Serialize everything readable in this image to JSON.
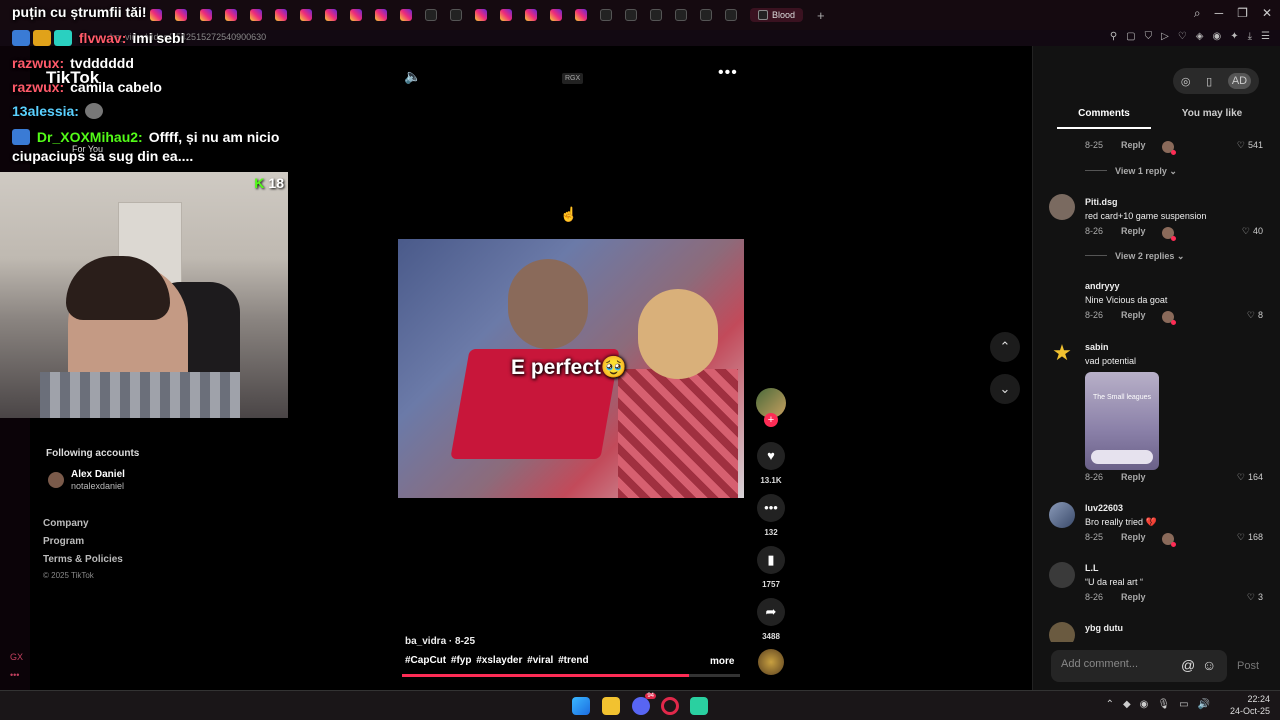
{
  "browser": {
    "active_tab_label": "Blood",
    "url": "ba_vidra/video/7542515272540900630",
    "new_tab_symbol": "+"
  },
  "chat": [
    {
      "user": "",
      "text": "puțin cu ștrumfii tăi!",
      "color": "#ffffff"
    },
    {
      "user": "flvwav:",
      "text": "imi sebi",
      "color": "#ff5a6a"
    },
    {
      "user": "razwux:",
      "text": "tvdddddd",
      "color": "#ff5a6a"
    },
    {
      "user": "razwux:",
      "text": "camila cabelo",
      "color": "#ff5a6a"
    },
    {
      "user": "13alessia:",
      "text": "",
      "color": "#5ad0ff"
    },
    {
      "user": "Dr_XOXMihau2:",
      "text": "Offff, și nu am nicio",
      "color": "#53fc18"
    },
    {
      "user": "",
      "text": "ciupaciups sa sug din ea....",
      "color": "#ffffff"
    }
  ],
  "webcam": {
    "counter": "18"
  },
  "tiktok_left": {
    "logo": "TikTok",
    "nav_item": "For You",
    "following_title": "Following accounts",
    "account_name": "Alex Daniel",
    "account_handle": "notalexdaniel",
    "footer_links": [
      "Company",
      "Program",
      "Terms & Policies"
    ],
    "copyright": "© 2025 TikTok"
  },
  "video": {
    "badge": "RGX",
    "caption": "E perfect🥹",
    "author_line": "ba_vidra · 8-25",
    "tags": "#CapCut #fyp #xslayder #viral #trend",
    "more": "more",
    "progress_fraction": 0.85,
    "likes": "13.1K",
    "comments": "132",
    "saves": "1757",
    "shares": "3488"
  },
  "comments_panel": {
    "tabs": [
      "Comments",
      "You may like"
    ],
    "items": [
      {
        "user": "",
        "text": "",
        "date": "8-25",
        "reply": "Reply",
        "likes": "541",
        "replies_label": "View 1 reply"
      },
      {
        "user": "Piti.dsg",
        "text": "red card+10 game suspension",
        "date": "8-26",
        "reply": "Reply",
        "likes": "40",
        "replies_label": "View 2 replies"
      },
      {
        "user": "andryyy",
        "text": "Nine Vicious da goat",
        "date": "8-26",
        "reply": "Reply",
        "likes": "8"
      },
      {
        "user": "sabin",
        "text": "vad potential",
        "date": "8-26",
        "reply": "Reply",
        "likes": "164",
        "sticker_text": "The Small leagues"
      },
      {
        "user": "luv22603",
        "text": "Bro really tried 💔",
        "date": "8-25",
        "reply": "Reply",
        "likes": "168"
      },
      {
        "user": "L.L",
        "text": "“U da real art “",
        "date": "8-26",
        "reply": "Reply",
        "likes": "3"
      },
      {
        "user": "ybg dutu",
        "text": "",
        "date": "",
        "reply": "",
        "likes": ""
      }
    ],
    "add_comment_placeholder": "Add comment...",
    "post_label": "Post"
  },
  "taskbar": {
    "time": "22:24",
    "date": "24-Oct-25",
    "discord_badge": "94"
  }
}
